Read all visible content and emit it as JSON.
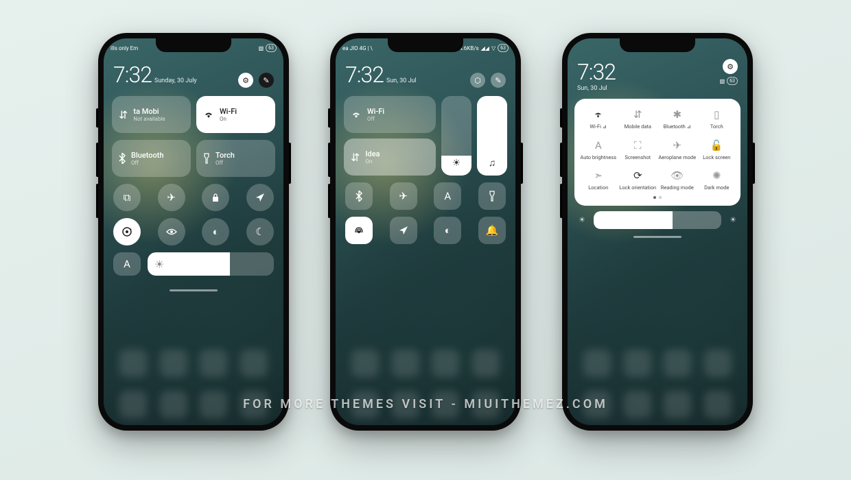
{
  "watermark": "FOR MORE THEMES VISIT - MIUITHEMEZ.COM",
  "phone1": {
    "status_left": "ills only     Em",
    "battery_icon": "63",
    "time": "7:32",
    "date": "Sunday, 30 July",
    "tiles": {
      "mobile": {
        "label": "ta    Mobi",
        "sub": "Not available"
      },
      "wifi": {
        "label": "Wi-Fi",
        "sub": "On"
      },
      "bt": {
        "label": "Bluetooth",
        "sub": "Off"
      },
      "torch": {
        "label": "Torch",
        "sub": "Off"
      }
    },
    "brightness_pct": 65
  },
  "phone2": {
    "status_left": "ea     JIO 4G | \\",
    "status_speed": "4.6KB/s",
    "battery_icon": "63",
    "time": "7:32",
    "date": "Sun, 30 Jul",
    "wifi": {
      "label": "Wi-Fi",
      "sub": "Off"
    },
    "idea": {
      "label": "Idea",
      "sub": "On"
    },
    "brightness_pct": 25,
    "volume_pct": 100
  },
  "phone3": {
    "time": "7:32",
    "date": "Sun, 30 Jul",
    "battery_icon": "63",
    "qs": [
      {
        "name": "wifi",
        "label": "Wi-Fi ⊿",
        "active": true
      },
      {
        "name": "mobile",
        "label": "Mobile data",
        "active": false
      },
      {
        "name": "bluetooth",
        "label": "Bluetooth ⊿",
        "active": false
      },
      {
        "name": "torch",
        "label": "Torch",
        "active": false
      },
      {
        "name": "autobright",
        "label": "Auto brightness",
        "active": false
      },
      {
        "name": "screenshot",
        "label": "Screenshot",
        "active": false
      },
      {
        "name": "aeroplane",
        "label": "Aeroplane mode",
        "active": false
      },
      {
        "name": "lockscreen",
        "label": "Lock screen",
        "active": false
      },
      {
        "name": "location",
        "label": "Location",
        "active": false
      },
      {
        "name": "lockorient",
        "label": "Lock orientation",
        "active": true
      },
      {
        "name": "reading",
        "label": "Reading mode",
        "active": false
      },
      {
        "name": "darkmode",
        "label": "Dark mode",
        "active": false
      }
    ],
    "brightness_pct": 62
  },
  "icons": {
    "wifi": "◖",
    "data": "⇵",
    "bt": "✱",
    "torch": "▮",
    "cast": "⧉",
    "plane": "✈",
    "lock": "🔒",
    "nav": "➤",
    "rot": "⟳",
    "eye": "👁",
    "contrast": "◐",
    "moon": "☾",
    "auto": "A",
    "sun": "☀",
    "music": "♫",
    "bell": "🔔",
    "gear": "⚙",
    "pen": "✎",
    "hex": "⬡",
    "edit": "✎",
    "screenshot": "⛶",
    "lockscr": "🔓"
  }
}
